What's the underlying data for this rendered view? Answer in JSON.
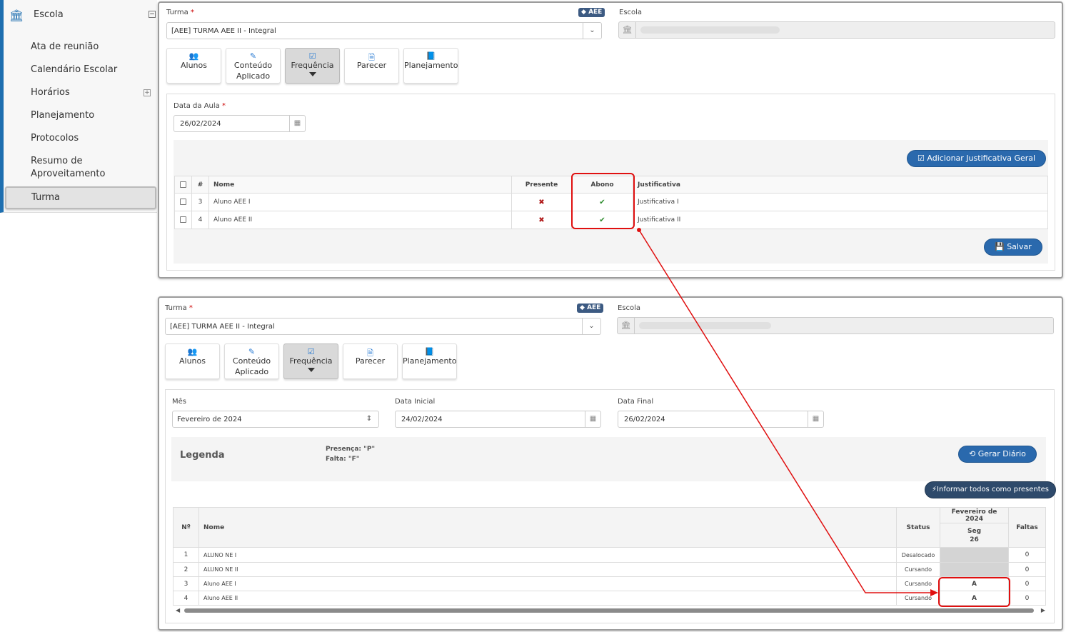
{
  "sidebar": {
    "header": "Escola",
    "items": [
      "Ata de reunião",
      "Calendário Escolar",
      "Horários",
      "Planejamento",
      "Protocolos",
      "Resumo de",
      "Aproveitamento"
    ],
    "active": "Turma"
  },
  "panel1": {
    "turma_label": "Turma",
    "required_mark": "*",
    "aee_badge": "AEE",
    "turma_value": "[AEE]  TURMA AEE II - Integral",
    "escola_label": "Escola",
    "buttons": {
      "alunos": "Alunos",
      "conteudo_1": "Conteúdo",
      "conteudo_2": "Aplicado",
      "frequencia": "Frequência",
      "parecer": "Parecer",
      "planejamento": "Planejamento"
    },
    "data_aula_label": "Data da Aula",
    "data_aula_value": "26/02/2024",
    "adicionar_btn": "Adicionar Justificativa Geral",
    "table_headers": {
      "num": "#",
      "nome": "Nome",
      "presente": "Presente",
      "abono": "Abono",
      "justificativa": "Justificativa"
    },
    "rows": [
      {
        "num": "3",
        "nome": "Aluno AEE I",
        "presente": "✖",
        "abono": "✔",
        "justificativa": "Justificativa I"
      },
      {
        "num": "4",
        "nome": "Aluno AEE II",
        "presente": "✖",
        "abono": "✔",
        "justificativa": "Justificativa II"
      }
    ],
    "salvar_btn": "Salvar"
  },
  "panel2": {
    "turma_label": "Turma",
    "required_mark": "*",
    "aee_badge": "AEE",
    "turma_value": "[AEE]  TURMA AEE II - Integral",
    "escola_label": "Escola",
    "buttons": {
      "alunos": "Alunos",
      "conteudo_1": "Conteúdo",
      "conteudo_2": "Aplicado",
      "frequencia": "Frequência",
      "parecer": "Parecer",
      "planejamento": "Planejamento"
    },
    "mes_label": "Mês",
    "mes_value": "Fevereiro de 2024",
    "data_inicial_label": "Data Inicial",
    "data_inicial_value": "24/02/2024",
    "data_final_label": "Data Final",
    "data_final_value": "26/02/2024",
    "legenda_title": "Legenda",
    "presenca_text": "Presença: \"P\"",
    "falta_text": "Falta: \"F\"",
    "gerar_btn": "Gerar Diário",
    "informar_btn": "Informar todos como presentes",
    "table_headers": {
      "num": "Nº",
      "nome": "Nome",
      "status": "Status",
      "month": "Fevereiro de 2024",
      "day_name": "Seg",
      "day_num": "26",
      "faltas": "Faltas"
    },
    "rows": [
      {
        "num": "1",
        "nome": "ALUNO NE I",
        "status": "Desalocado",
        "day": "",
        "faltas": "0"
      },
      {
        "num": "2",
        "nome": "ALUNO NE II",
        "status": "Cursando",
        "day": "",
        "faltas": "0"
      },
      {
        "num": "3",
        "nome": "Aluno AEE I",
        "status": "Cursando",
        "day": "A",
        "faltas": "0"
      },
      {
        "num": "4",
        "nome": "Aluno AEE II",
        "status": "Cursando",
        "day": "A",
        "faltas": "0"
      }
    ]
  },
  "colors": {
    "accent": "#2a69ad",
    "highlight": "#e01010",
    "sidebar_border": "#1e6fb0"
  }
}
